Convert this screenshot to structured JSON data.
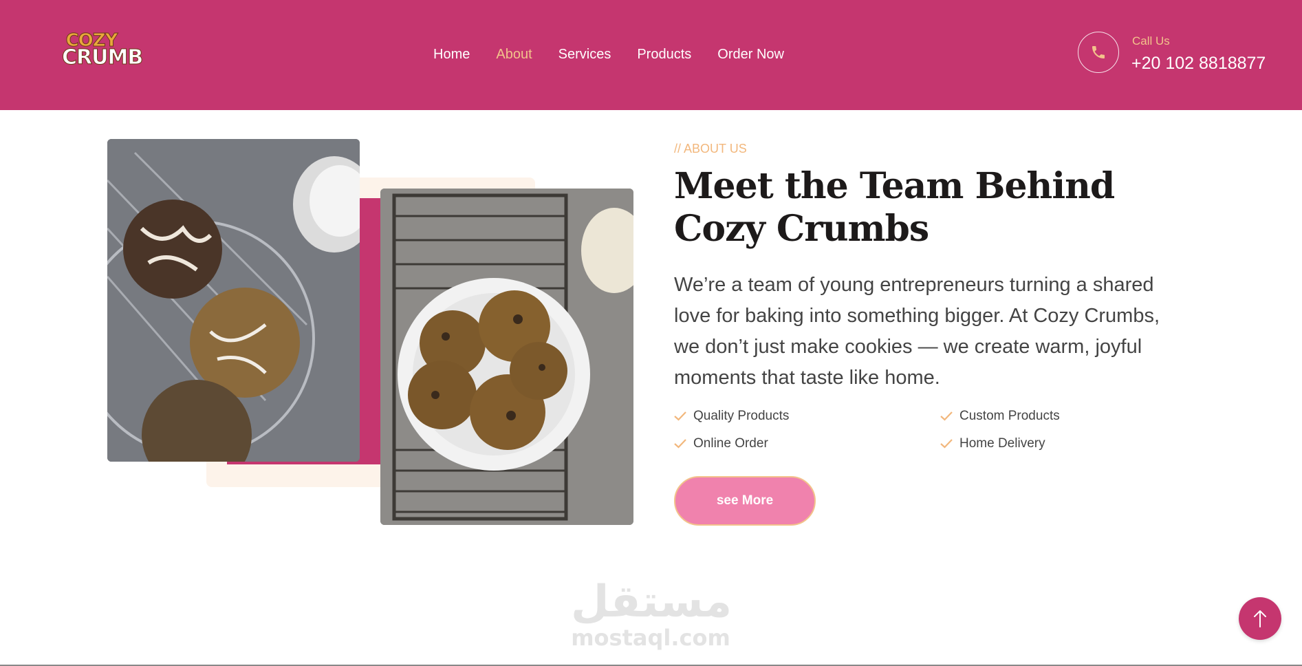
{
  "brand": {
    "logo_line1": "COZY",
    "logo_line2": "CRUMB",
    "primary_color": "#c5366f",
    "accent_color": "#f2c38b",
    "button_color": "#f082ad"
  },
  "nav": {
    "items": [
      {
        "label": "Home",
        "active": false
      },
      {
        "label": "About",
        "active": true
      },
      {
        "label": "Services",
        "active": false
      },
      {
        "label": "Products",
        "active": false
      },
      {
        "label": "Order Now",
        "active": false
      }
    ]
  },
  "contact": {
    "icon": "phone-icon",
    "label": "Call Us",
    "number": "+20 102 8818877"
  },
  "about": {
    "eyebrow": "// ABOUT US",
    "title": "Meet the Team Behind Cozy Crumbs",
    "description": "We’re a team of young entrepreneurs turning a shared love for baking into something bigger. At Cozy Crumbs, we don’t just make cookies — we create warm, joyful moments that taste like home.",
    "features": [
      "Quality Products",
      "Custom Products",
      "Online Order",
      "Home Delivery"
    ],
    "button_label": "see More"
  },
  "watermark": {
    "arabic": "مستقل",
    "latin": "mostaql.com"
  },
  "scroll_top_icon": "arrow-up-icon"
}
